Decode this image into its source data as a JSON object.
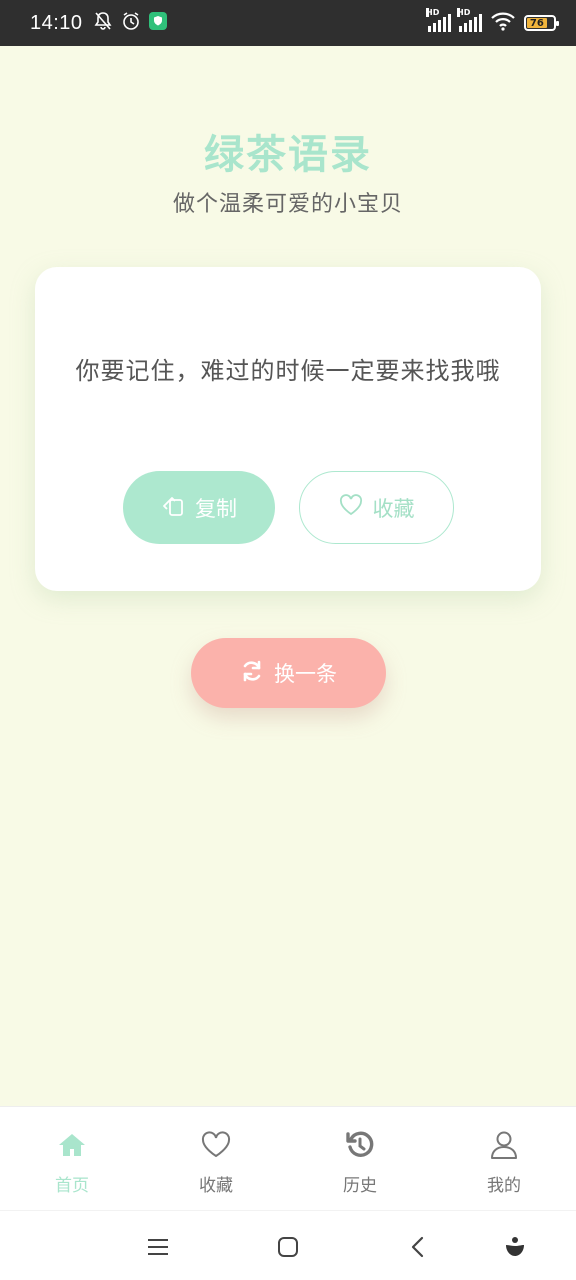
{
  "status_bar": {
    "time": "14:10",
    "battery_level": "76",
    "network_badge": "HD",
    "colors": {
      "background": "#2f2f2f",
      "battery": "#f0b43c",
      "shield": "#2fc07a"
    },
    "icons": [
      "bell-off-icon",
      "alarm-icon",
      "shield-icon",
      "signal-icon",
      "wifi-icon",
      "battery-icon"
    ]
  },
  "header": {
    "title": "绿茶语录",
    "subtitle": "做个温柔可爱的小宝贝"
  },
  "quote": {
    "text": "你要记住，难过的时候一定要来找我哦"
  },
  "actions": {
    "copy_label": "复制",
    "favorite_label": "收藏",
    "refresh_label": "换一条"
  },
  "bottom_nav": {
    "items": [
      {
        "label": "首页",
        "icon": "home-icon",
        "active": true
      },
      {
        "label": "收藏",
        "icon": "heart-icon",
        "active": false
      },
      {
        "label": "历史",
        "icon": "history-icon",
        "active": false
      },
      {
        "label": "我的",
        "icon": "user-icon",
        "active": false
      }
    ]
  },
  "system_nav": {
    "icons": [
      "menu-icon",
      "home-square-icon",
      "back-icon",
      "assistant-icon"
    ]
  },
  "colors": {
    "background": "#f8fae6",
    "accent_green": "#ade8cf",
    "accent_pink": "#fbb2ab",
    "text_gray": "#666666"
  }
}
